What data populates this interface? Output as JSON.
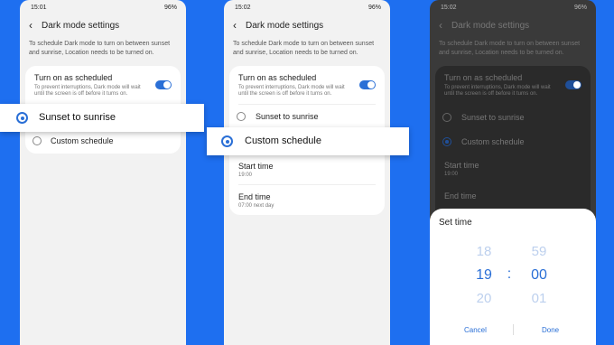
{
  "screens": [
    {
      "status": {
        "time": "15:01",
        "battery": "96%"
      },
      "header_title": "Dark mode settings",
      "description": "To schedule Dark mode to turn on between sunset and sunrise, Location needs to be turned on.",
      "schedule": {
        "title": "Turn on as scheduled",
        "subtitle": "To prevent interruptions, Dark mode will wait until the screen is off before it turns on."
      },
      "options": [
        "Sunset to sunrise",
        "Custom schedule"
      ],
      "highlighted_option": "Sunset to sunrise"
    },
    {
      "status": {
        "time": "15:02",
        "battery": "96%"
      },
      "header_title": "Dark mode settings",
      "description": "To schedule Dark mode to turn on between sunset and sunrise, Location needs to be turned on.",
      "schedule": {
        "title": "Turn on as scheduled",
        "subtitle": "To prevent interruptions, Dark mode will wait until the screen is off before it turns on."
      },
      "options": [
        "Sunset to sunrise",
        "Custom schedule"
      ],
      "highlighted_option": "Custom schedule",
      "start_time": {
        "label": "Start time",
        "value": "19:00"
      },
      "end_time": {
        "label": "End time",
        "value": "07:00 next day"
      }
    },
    {
      "status": {
        "time": "15:02",
        "battery": "96%"
      },
      "header_title": "Dark mode settings",
      "description": "To schedule Dark mode to turn on between sunset and sunrise, Location needs to be turned on.",
      "schedule": {
        "title": "Turn on as scheduled",
        "subtitle": "To prevent interruptions, Dark mode will wait until the screen is off before it turns on."
      },
      "options": [
        "Sunset to sunrise",
        "Custom schedule"
      ],
      "start_time": {
        "label": "Start time",
        "value": "19:00"
      },
      "end_time": {
        "label": "End time",
        "value": ""
      },
      "dialog": {
        "title": "Set time",
        "hours": [
          "18",
          "19",
          "20"
        ],
        "minutes": [
          "59",
          "00",
          "01"
        ],
        "separator": ":",
        "cancel": "Cancel",
        "done": "Done"
      }
    }
  ],
  "colors": {
    "background": "#1e6ff0",
    "accent": "#2a6fd6"
  }
}
